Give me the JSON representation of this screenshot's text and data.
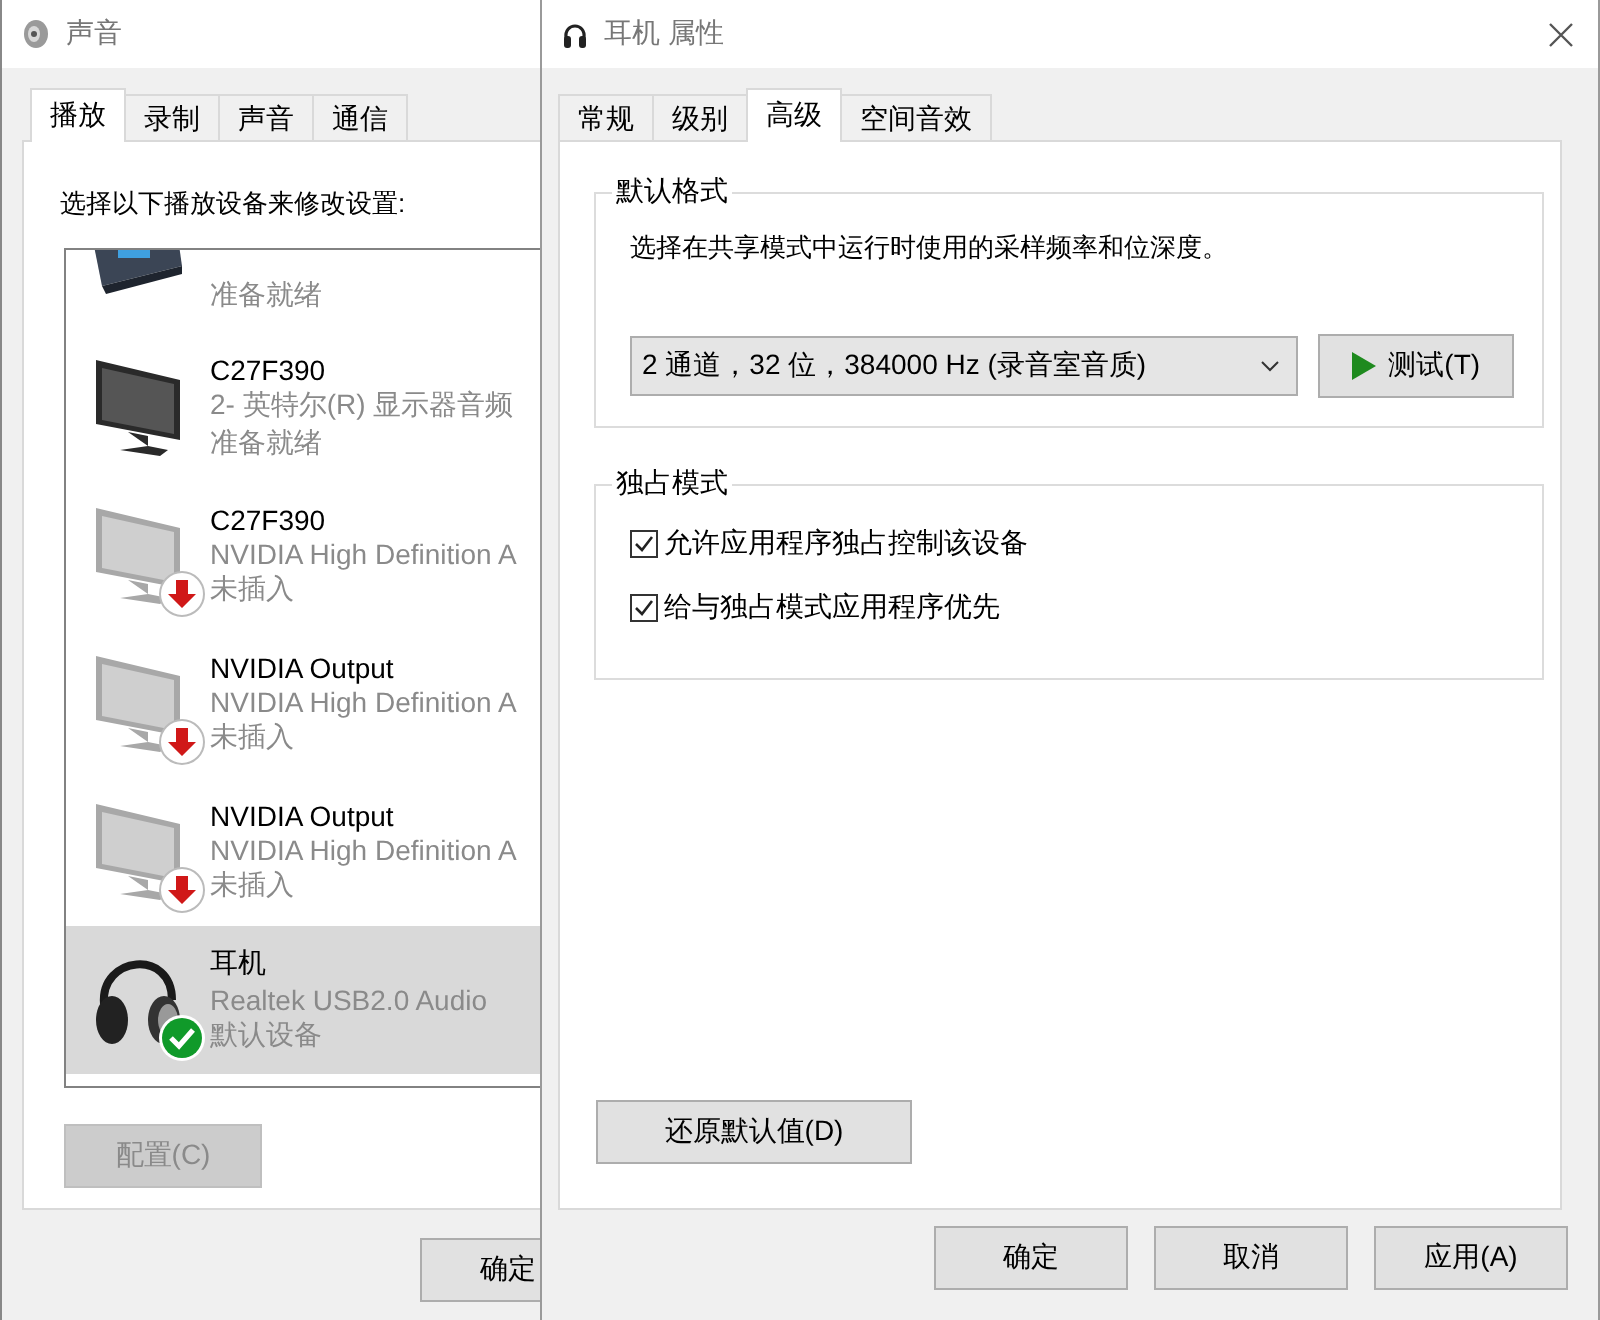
{
  "sound_window": {
    "title": "声音",
    "tabs": [
      {
        "label": "播放",
        "selected": true
      },
      {
        "label": "录制",
        "selected": false
      },
      {
        "label": "声音",
        "selected": false
      },
      {
        "label": "通信",
        "selected": false
      }
    ],
    "instruction": "选择以下播放设备来修改设置:",
    "devices": [
      {
        "kind": "receiver",
        "status": "准备就绪",
        "plugged_in": true,
        "default": false,
        "selected": false
      },
      {
        "kind": "monitor",
        "name": "C27F390",
        "driver": "2- 英特尔(R) 显示器音频",
        "status": "准备就绪",
        "plugged_in": true,
        "default": false,
        "selected": false
      },
      {
        "kind": "monitor",
        "name": "C27F390",
        "driver": "NVIDIA High Definition A",
        "status": "未插入",
        "plugged_in": false,
        "default": false,
        "selected": false
      },
      {
        "kind": "monitor",
        "name": "NVIDIA Output",
        "driver": "NVIDIA High Definition A",
        "status": "未插入",
        "plugged_in": false,
        "default": false,
        "selected": false
      },
      {
        "kind": "monitor",
        "name": "NVIDIA Output",
        "driver": "NVIDIA High Definition A",
        "status": "未插入",
        "plugged_in": false,
        "default": false,
        "selected": false
      },
      {
        "kind": "headphones",
        "name": "耳机",
        "driver": "Realtek USB2.0 Audio",
        "status": "默认设备",
        "plugged_in": true,
        "default": true,
        "selected": true
      }
    ],
    "configure_button": {
      "label": "配置(C)",
      "disabled": true
    },
    "ok_button": "确定"
  },
  "properties_window": {
    "title": "耳机 属性",
    "tabs": [
      {
        "label": "常规",
        "selected": false
      },
      {
        "label": "级别",
        "selected": false
      },
      {
        "label": "高级",
        "selected": true
      },
      {
        "label": "空间音效",
        "selected": false
      }
    ],
    "default_format": {
      "title": "默认格式",
      "description": "选择在共享模式中运行时使用的采样频率和位深度。",
      "format": "2 通道，32 位，384000 Hz (录音室音质)",
      "test_button": "测试(T)"
    },
    "exclusive_mode": {
      "title": "独占模式",
      "options": [
        {
          "label": "允许应用程序独占控制该设备",
          "checked": true
        },
        {
          "label": "给与独占模式应用程序优先",
          "checked": true
        }
      ]
    },
    "restore_button": "还原默认值(D)",
    "buttons": [
      "确定",
      "取消",
      "应用(A)"
    ]
  }
}
